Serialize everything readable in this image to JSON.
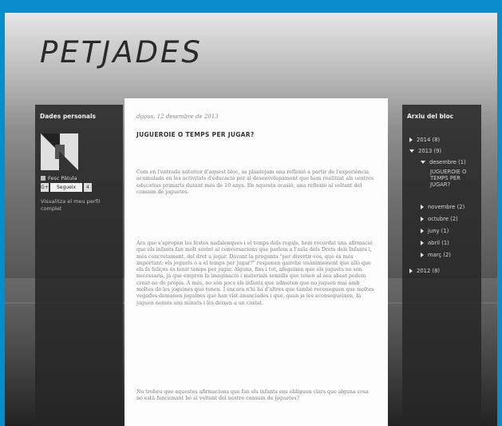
{
  "blog": {
    "title": "PETJADES"
  },
  "profile": {
    "section_title": "Dades personals",
    "name": "Fesc Pàtula",
    "follow_label": "Segueix",
    "follow_badge": "G+",
    "follow_count": "4",
    "view_profile": "Visualitza el meu perfil complet"
  },
  "post": {
    "date": "dijous, 12 desembre de 2013",
    "title": "JUGUEROIE O TEMPS PER JUGAR?",
    "paragraphs": [
      "Com en l'entrada anterior d'aquest bloc, us plantejam una reflexió a partir de l'experiència acumulada en les activitats d'educació per al desenvolupament que hem realitzat als centres educatius primaris durant més de 10 anys. En aquesta ocasió, una reflexió al voltant del consum de joguetes.",
      "Ara que s'apropen les festes nadalenques i el temps dels regals, hem recordat una afirmació que els infants fan molt sovint al conversacions que parlem a l'aula dels Drets dels Infants i, més concretament, del dret a jugar. Davant la pregunta \"per divertir-vos, què és més important: els joguets o a el temps per jugar?\" responen gairebé unànimement que allò que els fa feliços és tenir temps per jugar. Alguns, fins i tot, afegeixen que els joguets no són necessaris, ja que empren la imaginació i materials senzills que tenen al seu abast podem crear-ne de propis. A més, no són pocs els infants que admeten que no juguen mai amb moltes de les joguines que tenen. I encara n'hi ha d'altres que també reconeguen que moltes vegades demanen joguines que han vist anunciades i que, quan ja les aconsegueixen, hi juguen només uns minuts i les deixen a un costat.",
      "No trobeu que aquestes afirmacions que fan els infants ens obliguen clars que alguna cosa no està funcionant bé al voltant del nostre consum de joguetes?"
    ]
  },
  "archive": {
    "section_title": "Arxiu del bloc",
    "items": [
      {
        "label": "2014 (8)",
        "expanded": false
      },
      {
        "label": "2013 (9)",
        "expanded": true
      },
      {
        "label": "desembre (1)",
        "expanded": true
      },
      {
        "label": "JUGUEROIE O TEMPS PER JUGAR?"
      },
      {
        "label": "novembre (2)",
        "expanded": false
      },
      {
        "label": "octubre (2)",
        "expanded": false
      },
      {
        "label": "juny (1)",
        "expanded": false
      },
      {
        "label": "abril (1)",
        "expanded": false
      },
      {
        "label": "març (2)",
        "expanded": false
      },
      {
        "label": "2012 (8)",
        "expanded": false
      }
    ]
  },
  "colors": {
    "border": "#0a8ccc",
    "sidebar_bg": "#262626",
    "content_bg": "#fdfdfd"
  }
}
